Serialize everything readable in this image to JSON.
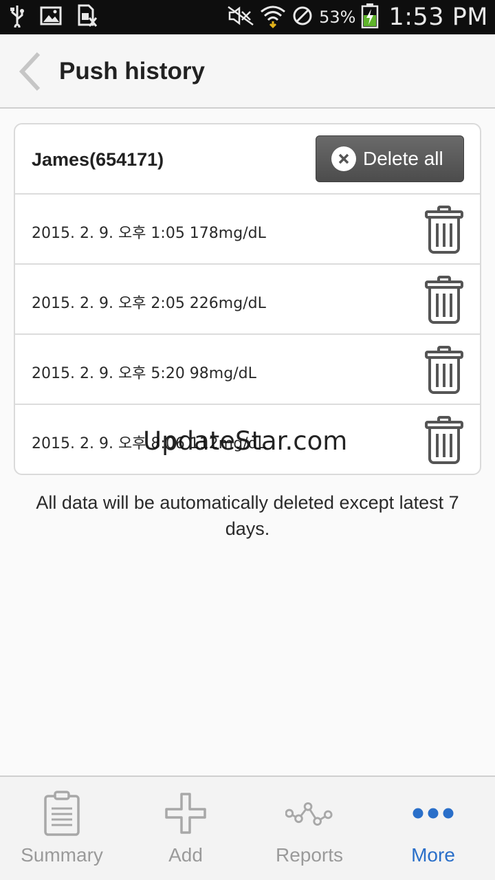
{
  "status_bar": {
    "battery_percent": "53%",
    "time": "1:53 PM",
    "icons": [
      "usb-icon",
      "image-icon",
      "sim-blocked-icon",
      "mute-icon",
      "wifi-icon",
      "blocked-icon",
      "battery-charging-icon"
    ]
  },
  "header": {
    "title": "Push history",
    "back_icon": "chevron-left-icon"
  },
  "card": {
    "user": "James(654171)",
    "delete_all_label": "Delete all",
    "rows": [
      {
        "text": "2015. 2. 9. 오후 1:05 178mg/dL"
      },
      {
        "text": "2015. 2. 9. 오후 2:05 226mg/dL"
      },
      {
        "text": "2015. 2. 9. 오후 5:20 98mg/dL"
      },
      {
        "text": "2015. 2. 9. 오후 8:06 112mg/dL"
      }
    ]
  },
  "watermark": "UpdateStar.com",
  "notice": "All data will be automatically deleted except latest 7 days.",
  "nav": {
    "items": [
      {
        "label": "Summary",
        "icon": "clipboard-icon"
      },
      {
        "label": "Add",
        "icon": "plus-icon"
      },
      {
        "label": "Reports",
        "icon": "chart-line-icon"
      },
      {
        "label": "More",
        "icon": "more-dots-icon"
      }
    ],
    "active": "More",
    "active_color": "#2a6fc9"
  }
}
